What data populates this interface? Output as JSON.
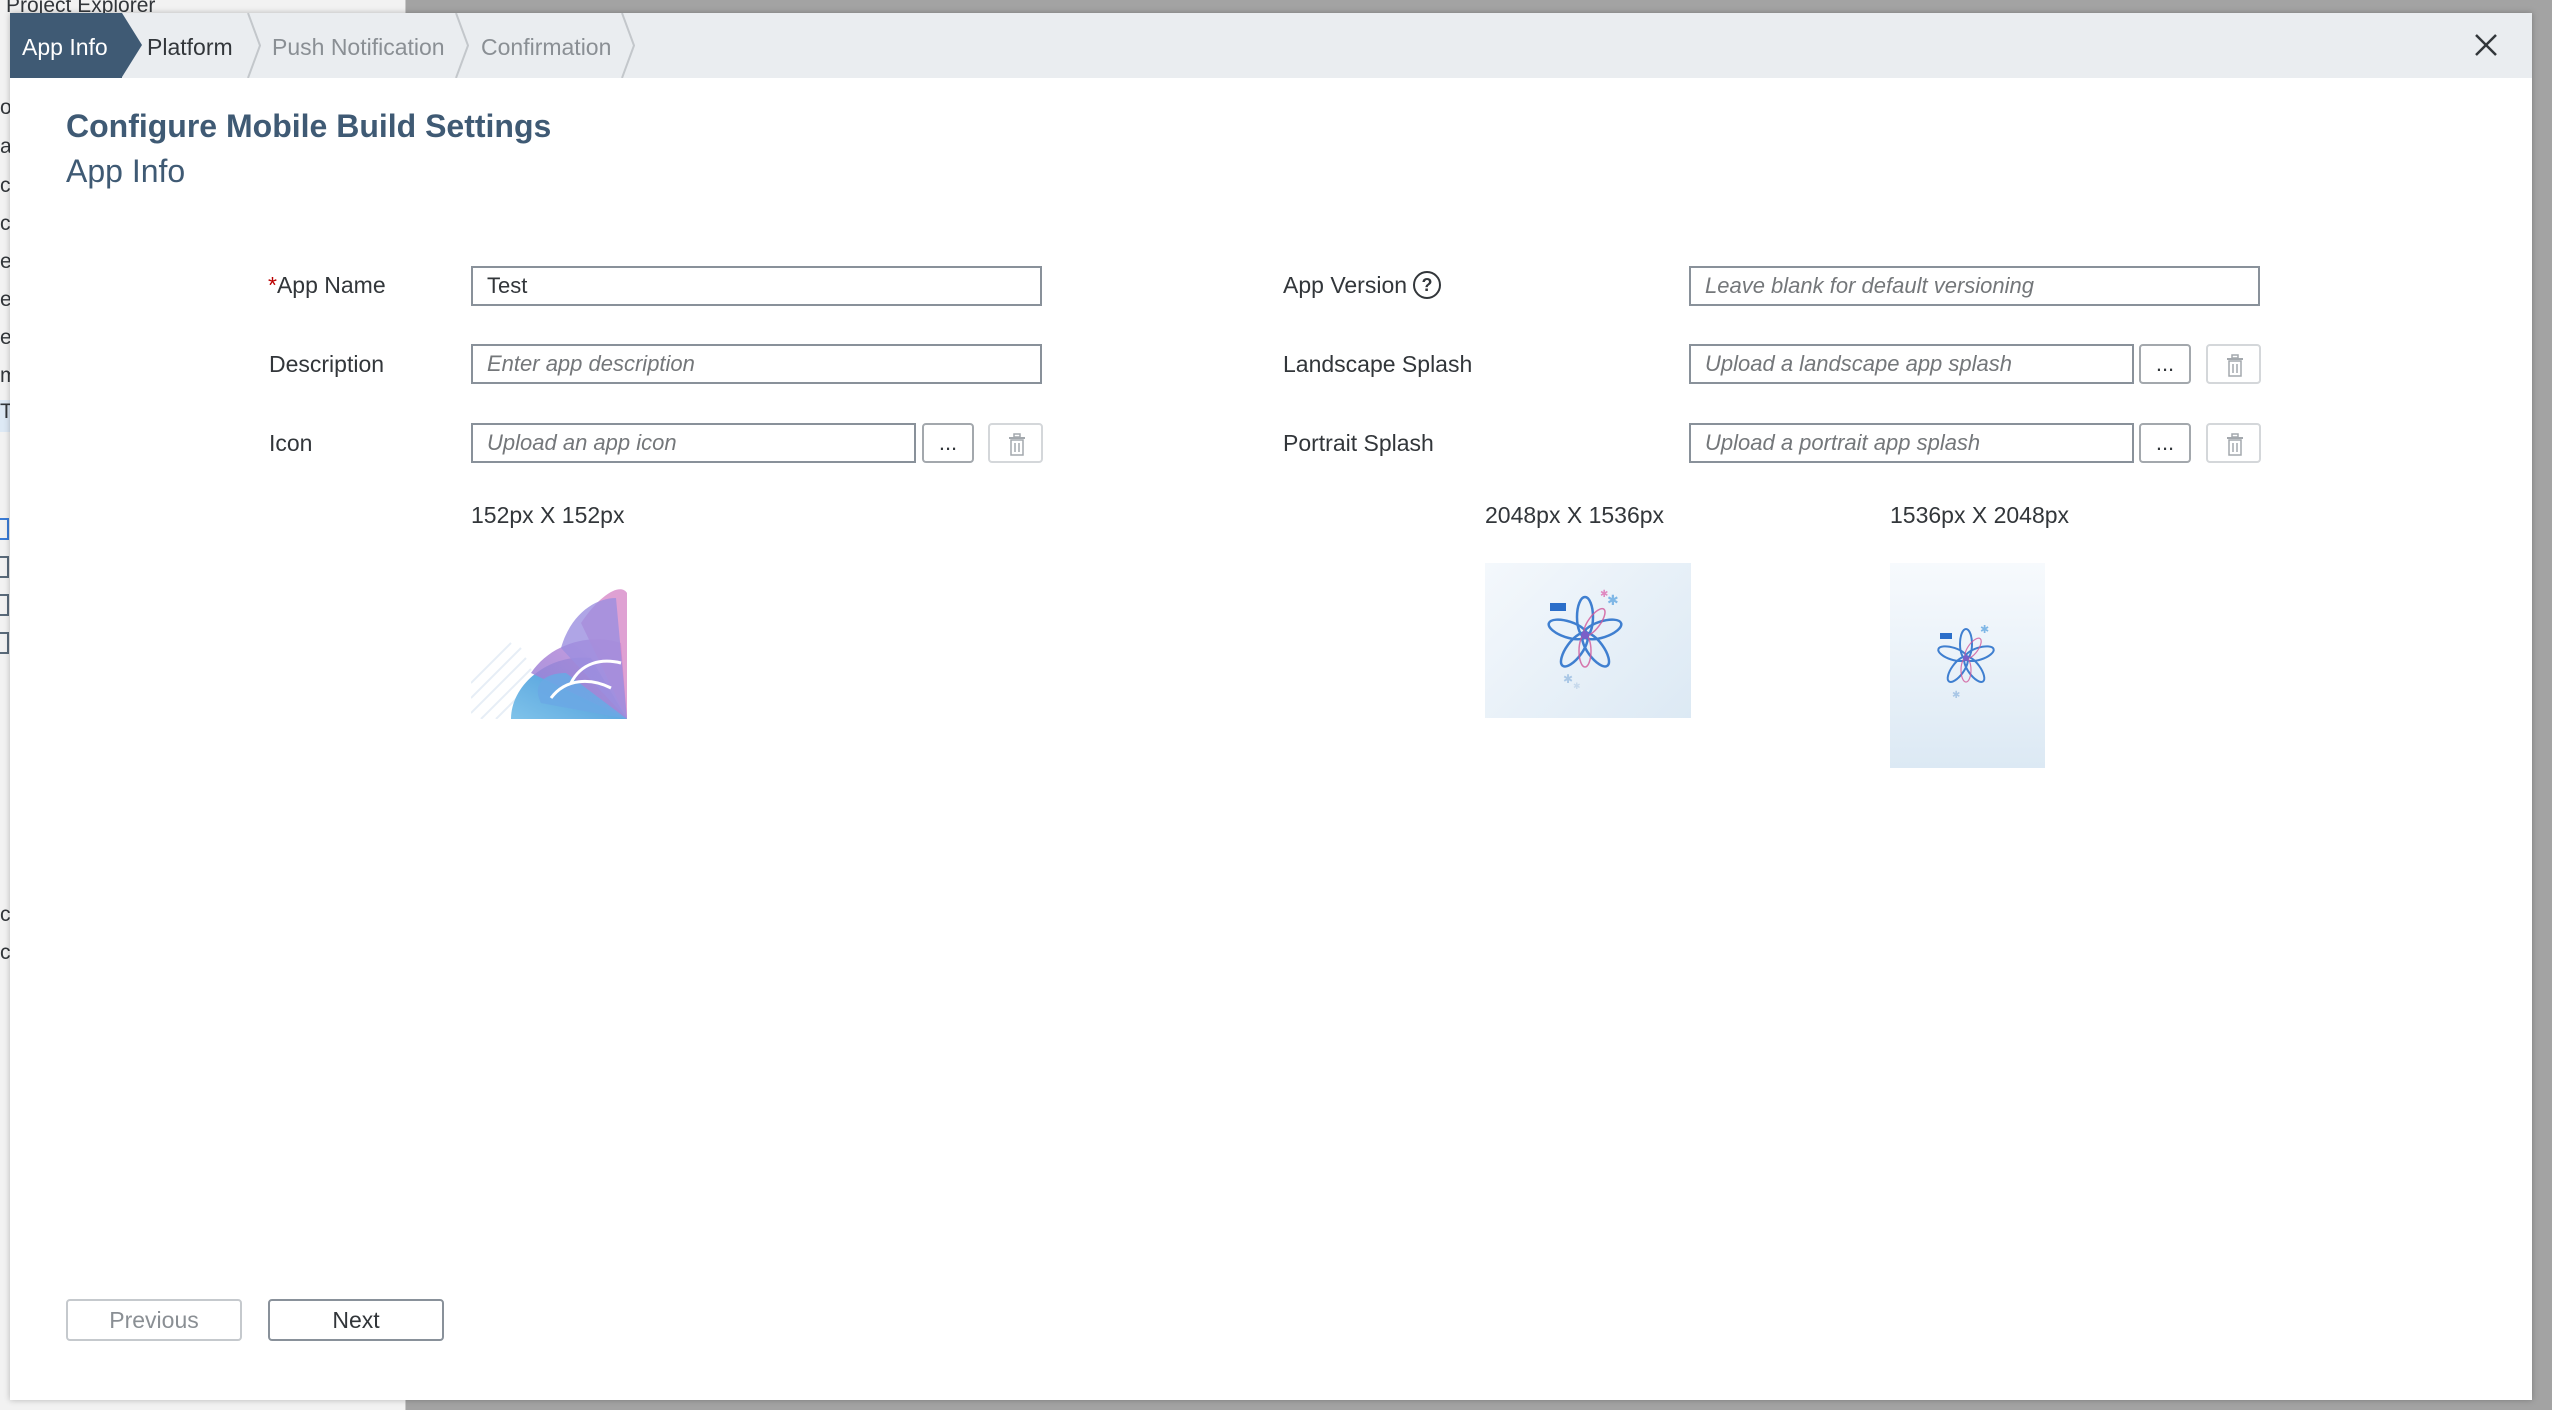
{
  "background": {
    "project_explorer_title": "Project Explorer",
    "fragments": [
      "o",
      "al",
      "ch",
      "cr",
      "el",
      "el",
      "el",
      "m",
      "Te",
      "cp",
      "cp"
    ]
  },
  "wizard": {
    "steps": [
      {
        "label": "App Info",
        "state": "active"
      },
      {
        "label": "Platform",
        "state": "done"
      },
      {
        "label": "Push Notification",
        "state": "future"
      },
      {
        "label": "Confirmation",
        "state": "future"
      }
    ],
    "close_icon": "close-icon"
  },
  "dialog": {
    "title": "Configure Mobile Build Settings",
    "subtitle": "App Info"
  },
  "form": {
    "app_name": {
      "required_mark": "*",
      "label": "App Name",
      "value": "Test"
    },
    "description": {
      "label": "Description",
      "value": "",
      "placeholder": "Enter app description"
    },
    "icon": {
      "label": "Icon",
      "value": "",
      "placeholder": "Upload an app icon",
      "browse_label": "...",
      "size_hint": "152px X 152px"
    },
    "app_version": {
      "label": "App Version",
      "value": "",
      "placeholder": "Leave blank for default versioning",
      "help_icon": "question-circle-icon"
    },
    "landscape_splash": {
      "label": "Landscape Splash",
      "value": "",
      "placeholder": "Upload a landscape app splash",
      "browse_label": "...",
      "size_hint": "2048px X 1536px"
    },
    "portrait_splash": {
      "label": "Portrait Splash",
      "value": "",
      "placeholder": "Upload a portrait app splash",
      "browse_label": "...",
      "size_hint": "1536px X 2048px"
    },
    "delete_icon": "trash-icon"
  },
  "footer": {
    "previous_label": "Previous",
    "next_label": "Next"
  },
  "colors": {
    "accent": "#3f5a74",
    "required": "#bb0000",
    "wizard_bar": "#eaedf0"
  }
}
